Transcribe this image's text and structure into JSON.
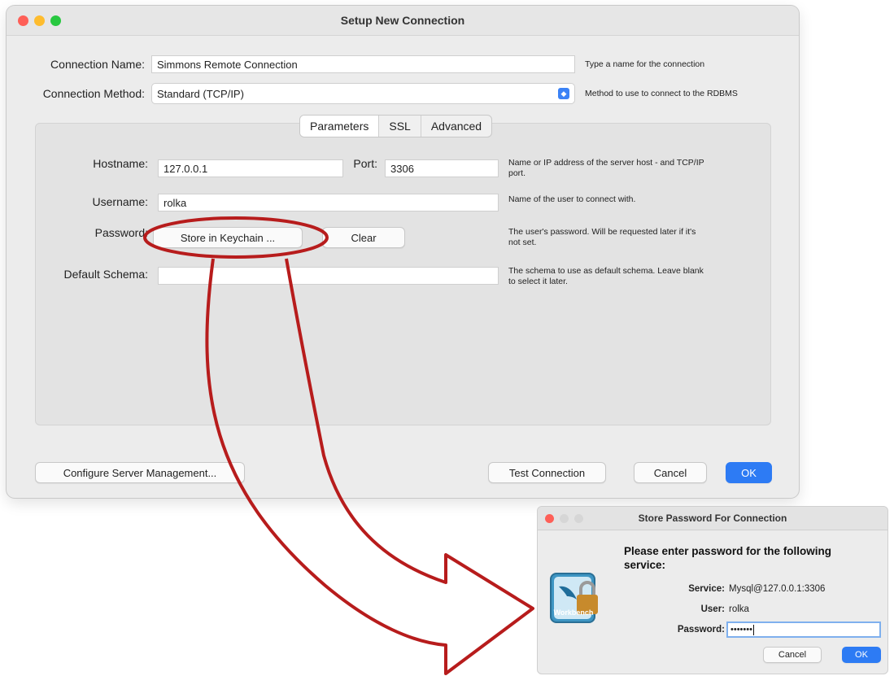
{
  "main_window": {
    "title": "Setup New Connection",
    "connection_name": {
      "label": "Connection Name:",
      "value": "Simmons Remote Connection",
      "hint": "Type a name for the connection"
    },
    "connection_method": {
      "label": "Connection Method:",
      "value": "Standard (TCP/IP)",
      "hint": "Method to use to connect to the RDBMS"
    },
    "tabs": [
      {
        "label": "Parameters",
        "active": true
      },
      {
        "label": "SSL",
        "active": false
      },
      {
        "label": "Advanced",
        "active": false
      }
    ],
    "hostname": {
      "label": "Hostname:",
      "value": "127.0.0.1",
      "hint_line1": "Name or IP address of the server host - and TCP/IP",
      "hint_line2": "port."
    },
    "port": {
      "label": "Port:",
      "value": "3306"
    },
    "username": {
      "label": "Username:",
      "value": "rolka",
      "hint": "Name of the user to connect with."
    },
    "password": {
      "label": "Password:",
      "store_button": "Store in Keychain ...",
      "clear_button": "Clear",
      "hint_line1": "The user's password. Will be requested later if it's",
      "hint_line2": "not set."
    },
    "default_schema": {
      "label": "Default Schema:",
      "value": "",
      "hint_line1": "The schema to use as default schema. Leave blank",
      "hint_line2": "to select it later."
    },
    "footer": {
      "configure_button": "Configure Server Management...",
      "test_button": "Test Connection",
      "cancel_button": "Cancel",
      "ok_button": "OK"
    }
  },
  "password_dialog": {
    "title": "Store Password For Connection",
    "heading_line1": "Please enter password for the following",
    "heading_line2": "service:",
    "service_label": "Service:",
    "service_value": "Mysql@127.0.0.1:3306",
    "user_label": "User:",
    "user_value": "rolka",
    "password_label": "Password:",
    "password_value": "•••••••",
    "cancel_button": "Cancel",
    "ok_button": "OK",
    "logo_text": "Workbench"
  },
  "colors": {
    "annotation": "#b71c1c",
    "accent": "#2d7bf4",
    "traffic_red": "#fe5f57",
    "traffic_yellow": "#febc2e",
    "traffic_green": "#28c840"
  }
}
